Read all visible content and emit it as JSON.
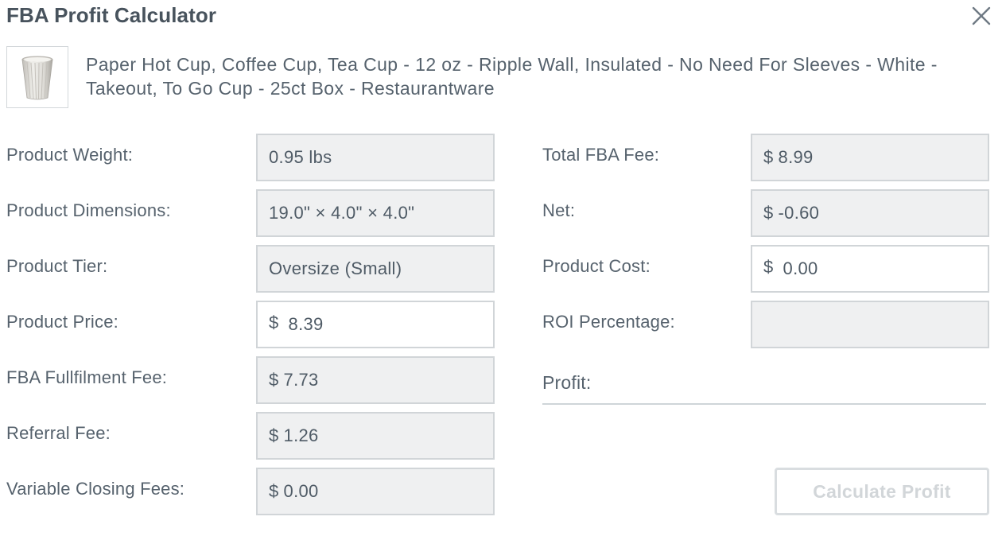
{
  "dialog": {
    "title": "FBA Profit Calculator",
    "close_icon": "close-icon"
  },
  "product": {
    "thumbnail_icon": "paper-cup-image",
    "name": "Paper Hot Cup, Coffee Cup, Tea Cup - 12 oz - Ripple Wall, Insulated - No Need For Sleeves - White - Takeout, To Go Cup - 25ct Box - Restaurantware"
  },
  "left_fields": [
    {
      "label": "Product Weight:",
      "currency": "",
      "value": "0.95 lbs",
      "editable": false
    },
    {
      "label": "Product Dimensions:",
      "currency": "",
      "value": "19.0\" × 4.0\" × 4.0\"",
      "editable": false
    },
    {
      "label": "Product Tier:",
      "currency": "",
      "value": "Oversize (Small)",
      "editable": false
    },
    {
      "label": "Product Price:",
      "currency": "$",
      "value": "8.39",
      "editable": true
    },
    {
      "label": "FBA Fullfilment Fee:",
      "currency": "$",
      "value": "7.73",
      "editable": false
    },
    {
      "label": "Referral Fee:",
      "currency": "$",
      "value": "1.26",
      "editable": false
    },
    {
      "label": "Variable Closing Fees:",
      "currency": "$",
      "value": "0.00",
      "editable": false
    }
  ],
  "right_fields": [
    {
      "label": "Total FBA Fee:",
      "currency": "$",
      "value": "8.99",
      "editable": false
    },
    {
      "label": "Net:",
      "currency": "$",
      "value": "-0.60",
      "editable": false
    },
    {
      "label": "Product Cost:",
      "currency": "$",
      "value": "0.00",
      "editable": true
    },
    {
      "label": "ROI Percentage:",
      "currency": "",
      "value": "",
      "editable": false
    }
  ],
  "profit": {
    "label": "Profit:",
    "value": ""
  },
  "actions": {
    "calculate_label": "Calculate Profit"
  },
  "colors": {
    "text": "#56626d",
    "readonly_bg": "#eff0f1",
    "border": "#d1d5d8",
    "button_disabled": "#d2d6d9"
  }
}
